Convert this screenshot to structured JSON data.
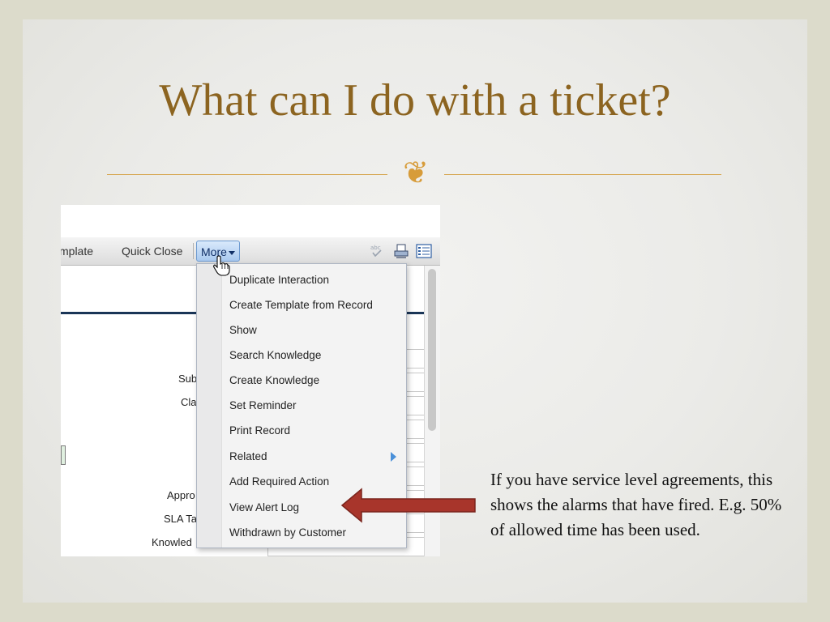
{
  "slide": {
    "title": "What can I do with a ticket?",
    "note": "If you have service level agreements, this shows the alarms that have fired. E.g. 50% of allowed time has been used."
  },
  "toolbar": {
    "items": [
      "mplate",
      "Quick Close"
    ],
    "more_label": "More",
    "icons": [
      "spellcheck-icon",
      "print-icon",
      "list-icon"
    ]
  },
  "menu": {
    "items": [
      "Duplicate Interaction",
      "Create Template from Record",
      "Show",
      "Search Knowledge",
      "Create Knowledge",
      "Set Reminder",
      "Print Record",
      "Related",
      "Add Required Action",
      "View Alert Log",
      "Withdrawn by Customer"
    ]
  },
  "form": {
    "labels": [
      "Sub",
      "Cla",
      "Appro",
      "SLA Ta",
      "Knowled"
    ]
  },
  "colors": {
    "title": "#8c6420",
    "accent_rule": "#d7a957",
    "arrow": "#a8352b",
    "menu_highlight": "#a9c9ef"
  }
}
